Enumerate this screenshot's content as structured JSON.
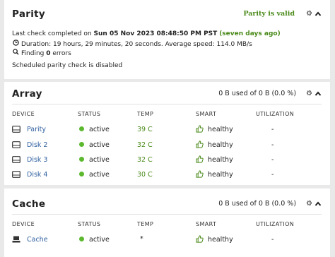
{
  "parity": {
    "title": "Parity",
    "status": "Parity is valid",
    "last_check_prefix": "Last check completed on ",
    "last_check_date": "Sun 05 Nov 2023 08:48:50 PM PST",
    "last_check_ago": "(seven days ago)",
    "duration": "Duration: 19 hours, 29 minutes, 20 seconds. Average speed: 114.0 MB/s",
    "finding_prefix": "Finding ",
    "finding_count": "0",
    "finding_suffix": " errors",
    "scheduled": "Scheduled parity check is disabled"
  },
  "array": {
    "title": "Array",
    "usage": "0 B used of 0 B (0.0 %)",
    "columns": [
      "DEVICE",
      "STATUS",
      "TEMP",
      "SMART",
      "UTILIZATION"
    ],
    "rows": [
      {
        "device": "Parity",
        "status": "active",
        "temp": "39 C",
        "smart": "healthy",
        "util": "-"
      },
      {
        "device": "Disk 2",
        "status": "active",
        "temp": "32 C",
        "smart": "healthy",
        "util": "-"
      },
      {
        "device": "Disk 3",
        "status": "active",
        "temp": "32 C",
        "smart": "healthy",
        "util": "-"
      },
      {
        "device": "Disk 4",
        "status": "active",
        "temp": "30 C",
        "smart": "healthy",
        "util": "-"
      }
    ]
  },
  "cache": {
    "title": "Cache",
    "usage": "0 B used of 0 B (0.0 %)",
    "columns": [
      "DEVICE",
      "STATUS",
      "TEMP",
      "SMART",
      "UTILIZATION"
    ],
    "rows": [
      {
        "device": "Cache",
        "status": "active",
        "temp": "*",
        "smart": "healthy",
        "util": "-"
      }
    ]
  },
  "colors": {
    "green_text": "#4a8a1a",
    "status_dot": "#5cb82e",
    "link": "#2f5f9f"
  },
  "icons": {
    "settings": "gear-icon",
    "collapse": "chevron-up-icon",
    "duration": "clock-icon",
    "finding": "search-icon",
    "disk": "hard-disk-icon",
    "cache": "cache-device-icon",
    "smart": "thumbs-up-icon"
  }
}
